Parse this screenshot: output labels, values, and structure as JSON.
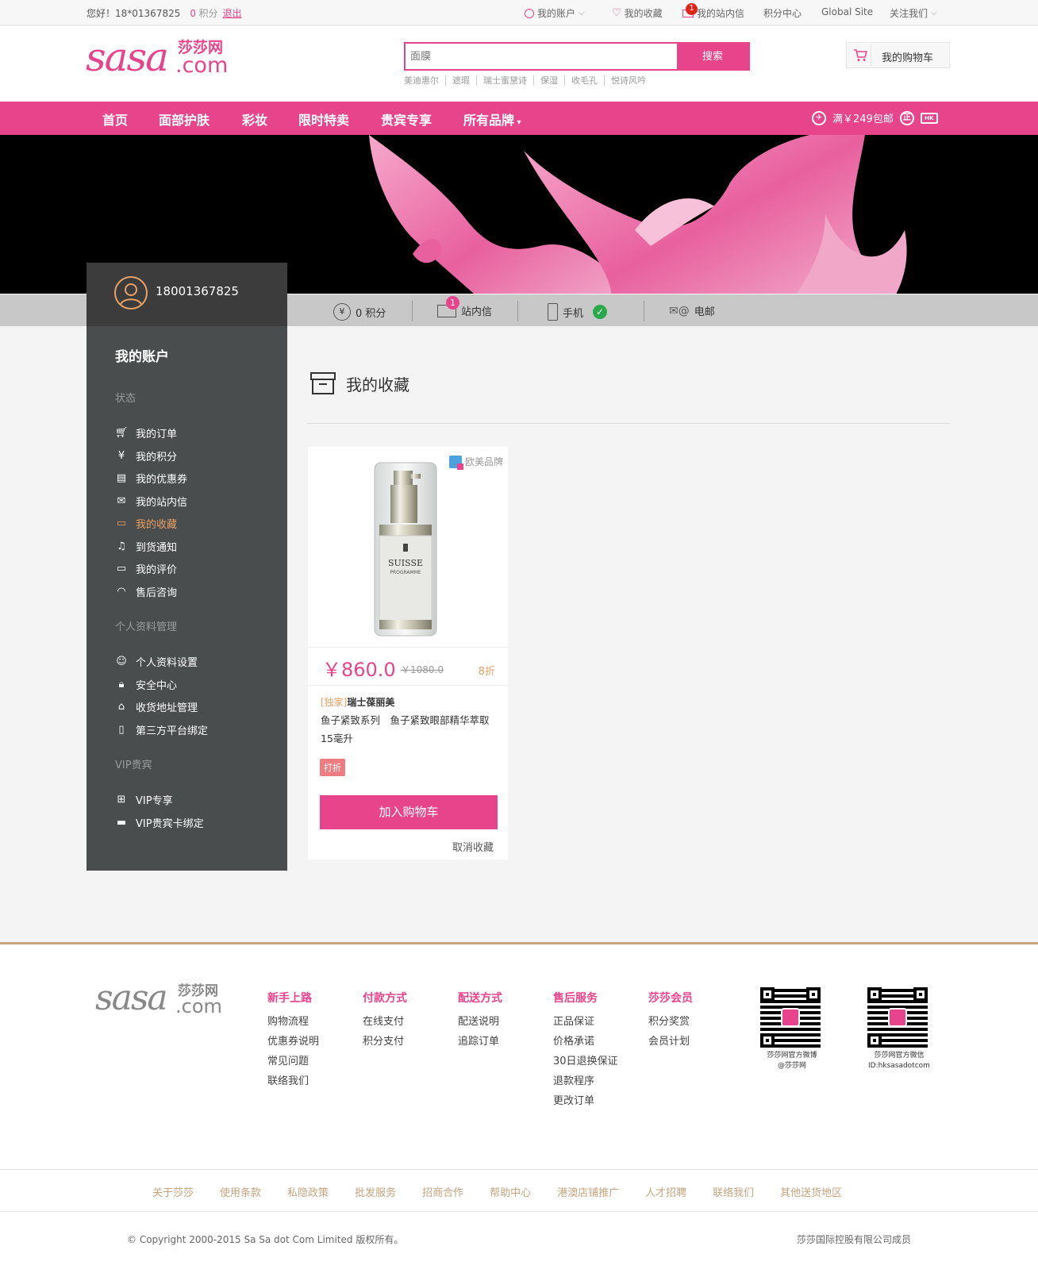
{
  "topbar": {
    "greeting": "您好！18*01367825",
    "points": "0",
    "points_label": "积分",
    "logout": "退出",
    "my_account": "我的账户",
    "my_favorites": "我的收藏",
    "inbox": "我的站内信",
    "inbox_count": "1",
    "points_center": "积分中心",
    "global_site": "Global Site",
    "follow_us": "关注我们"
  },
  "header": {
    "logo_main": "sasa",
    "logo_cn": "莎莎网",
    "logo_com": ".com",
    "search_placeholder": "面膜",
    "search_button": "搜索",
    "hot_words": [
      "美迪惠尔",
      "遮瑕",
      "瑞士蜜黛诗",
      "保湿",
      "收毛孔",
      "悦诗风吟"
    ],
    "cart": "我的购物车"
  },
  "mainnav": {
    "items": [
      "首页",
      "面部护肤",
      "彩妆",
      "限时特卖",
      "贵宾专享",
      "所有品牌"
    ],
    "shipping": "满￥249包邮"
  },
  "user": {
    "phone": "18001367825"
  },
  "statusbar": {
    "points": "0 积分",
    "inbox": "站内信",
    "inbox_count": "1",
    "mobile": "手机",
    "email": "电邮"
  },
  "sidebar": {
    "title": "我的账户",
    "sections": [
      {
        "title": "状态",
        "items": [
          "我的订单",
          "我的积分",
          "我的优惠券",
          "我的站内信",
          "我的收藏",
          "到货通知",
          "我的评价",
          "售后咨询"
        ]
      },
      {
        "title": "个人资料管理",
        "items": [
          "个人资料设置",
          "安全中心",
          "收货地址管理",
          "第三方平台绑定"
        ]
      },
      {
        "title": "VIP贵宾",
        "items": [
          "VIP专享",
          "VIP贵宾卡绑定"
        ]
      }
    ],
    "active": "我的收藏"
  },
  "content": {
    "title": "我的收藏",
    "product": {
      "tag": "欧美品牌",
      "price": "￥860.0",
      "old_price": "￥1080.0",
      "discount": "8折",
      "exclusive": "[独家]",
      "brand": "瑞士葆丽美",
      "desc": "鱼子紧致系列　鱼子紧致眼部精华萃取 15毫升",
      "promo": "打折",
      "add_cart": "加入购物车",
      "cancel": "取消收藏",
      "bottle_brand": "SUISSE",
      "bottle_sub": "PROGRAMME"
    }
  },
  "footer": {
    "logo_main": "sasa",
    "logo_cn": "莎莎网",
    "logo_com": ".com",
    "columns": [
      {
        "title": "新手上路",
        "links": [
          "购物流程",
          "优惠券说明",
          "常见问题",
          "联络我们"
        ]
      },
      {
        "title": "付款方式",
        "links": [
          "在线支付",
          "积分支付"
        ]
      },
      {
        "title": "配送方式",
        "links": [
          "配送说明",
          "追踪订单"
        ]
      },
      {
        "title": "售后服务",
        "links": [
          "正品保证",
          "价格承诺",
          "30日退换保证",
          "退款程序",
          "更改订单"
        ]
      },
      {
        "title": "莎莎会员",
        "links": [
          "积分奖赏",
          "会员计划"
        ]
      }
    ],
    "qr1_caption": [
      "莎莎网官方微博",
      "@莎莎网"
    ],
    "qr2_caption": [
      "莎莎网官方微信",
      "ID:hksasadotcom"
    ],
    "bottom_links": [
      "关于莎莎",
      "使用条款",
      "私隐政策",
      "批发服务",
      "招商合作",
      "帮助中心",
      "港澳店铺推广",
      "人才招聘",
      "联络我们",
      "其他送货地区"
    ],
    "copyright": "© Copyright 2000-2015 Sa Sa dot Com Limited 版权所有。",
    "member": "莎莎国际控股有限公司成员"
  },
  "colors": {
    "brand_pink": "#e8448b",
    "accent_gold": "#c5a47e",
    "sidebar_bg": "#4a4d4d"
  }
}
